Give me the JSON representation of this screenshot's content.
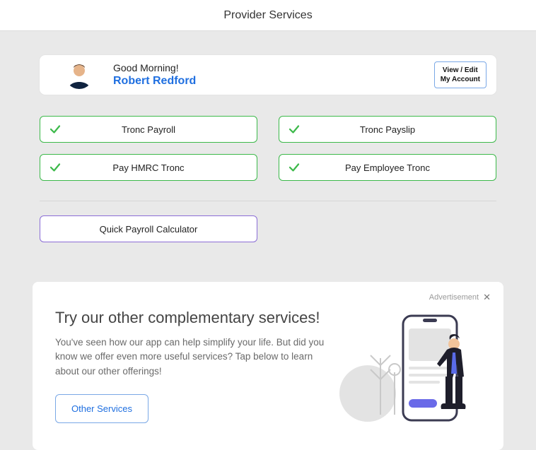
{
  "header": {
    "title": "Provider Services"
  },
  "user": {
    "greeting": "Good Morning!",
    "name": "Robert Redford",
    "account_btn_line1": "View  /  Edit",
    "account_btn_line2": "My  Account"
  },
  "actions": {
    "left": [
      {
        "label": "Tronc  Payroll"
      },
      {
        "label": "Pay  HMRC  Tronc"
      }
    ],
    "right": [
      {
        "label": "Tronc  Payslip"
      },
      {
        "label": "Pay  Employee  Tronc"
      }
    ]
  },
  "quick": {
    "label": "Quick  Payroll  Calculator"
  },
  "promo": {
    "tag": "Advertisement",
    "title": "Try our other complementary services!",
    "desc": "You've seen how our app can help simplify your life. But did you know we offer even more useful services? Tap below to learn about our other offerings!",
    "cta": "Other  Services"
  }
}
